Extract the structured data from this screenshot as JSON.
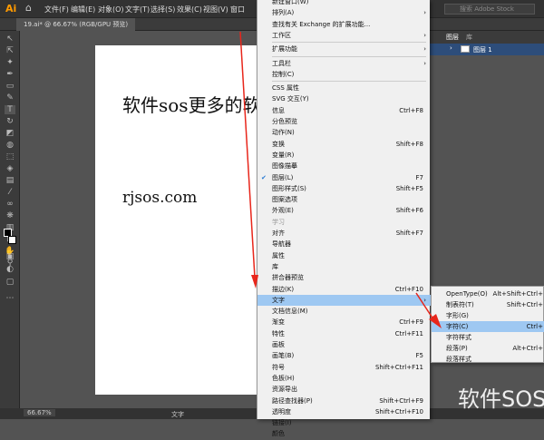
{
  "app": {
    "logo": "Ai",
    "window_title": "19.ai* @ 66.67% (RGB/GPU 预览)"
  },
  "menubar": [
    "文件(F)",
    "编辑(E)",
    "对象(O)",
    "文字(T)",
    "选择(S)",
    "效果(C)",
    "视图(V)",
    "窗口"
  ],
  "search": {
    "placeholder": "搜索 Adobe Stock"
  },
  "canvas": {
    "heading": "软件sos更多的软件",
    "url": "rjsos.com"
  },
  "status": {
    "zoom": "66.67%",
    "tool": "文字"
  },
  "layers": {
    "tabs": [
      "图层",
      "库"
    ],
    "layer_name": "图层 1"
  },
  "window_menu": [
    {
      "label": "新建窗口(W)",
      "shortcut": "",
      "arrow": false
    },
    {
      "label": "排列(A)",
      "shortcut": "",
      "arrow": true
    },
    {
      "label": "查找有关 Exchange 的扩展功能...",
      "shortcut": "",
      "arrow": false
    },
    {
      "label": "工作区",
      "shortcut": "",
      "arrow": true
    },
    {
      "label": "扩展功能",
      "shortcut": "",
      "arrow": true
    },
    {
      "label": "工具栏",
      "shortcut": "",
      "arrow": true
    },
    {
      "label": "控制(C)",
      "shortcut": "",
      "arrow": false
    },
    {
      "label": "CSS 属性",
      "shortcut": "",
      "arrow": false
    },
    {
      "label": "SVG 交互(Y)",
      "shortcut": "",
      "arrow": false
    },
    {
      "label": "信息",
      "shortcut": "Ctrl+F8",
      "arrow": false
    },
    {
      "label": "分色预览",
      "shortcut": "",
      "arrow": false
    },
    {
      "label": "动作(N)",
      "shortcut": "",
      "arrow": false
    },
    {
      "label": "变换",
      "shortcut": "Shift+F8",
      "arrow": false
    },
    {
      "label": "变量(R)",
      "shortcut": "",
      "arrow": false
    },
    {
      "label": "图像描摹",
      "shortcut": "",
      "arrow": false
    },
    {
      "label": "图层(L)",
      "shortcut": "F7",
      "arrow": false,
      "checked": true
    },
    {
      "label": "图形样式(S)",
      "shortcut": "Shift+F5",
      "arrow": false
    },
    {
      "label": "图案选项",
      "shortcut": "",
      "arrow": false
    },
    {
      "label": "外观(E)",
      "shortcut": "Shift+F6",
      "arrow": false
    },
    {
      "label": "学习",
      "shortcut": "",
      "arrow": false,
      "disabled": true
    },
    {
      "label": "对齐",
      "shortcut": "Shift+F7",
      "arrow": false
    },
    {
      "label": "导航器",
      "shortcut": "",
      "arrow": false
    },
    {
      "label": "属性",
      "shortcut": "",
      "arrow": false
    },
    {
      "label": "库",
      "shortcut": "",
      "arrow": false
    },
    {
      "label": "拼合器预览",
      "shortcut": "",
      "arrow": false
    },
    {
      "label": "描边(K)",
      "shortcut": "Ctrl+F10",
      "arrow": false
    },
    {
      "label": "文字",
      "shortcut": "",
      "arrow": true,
      "highlighted": true
    },
    {
      "label": "文档信息(M)",
      "shortcut": "",
      "arrow": false
    },
    {
      "label": "渐变",
      "shortcut": "Ctrl+F9",
      "arrow": false
    },
    {
      "label": "特性",
      "shortcut": "Ctrl+F11",
      "arrow": false
    },
    {
      "label": "画板",
      "shortcut": "",
      "arrow": false
    },
    {
      "label": "画笔(B)",
      "shortcut": "F5",
      "arrow": false
    },
    {
      "label": "符号",
      "shortcut": "Shift+Ctrl+F11",
      "arrow": false
    },
    {
      "label": "色板(H)",
      "shortcut": "",
      "arrow": false
    },
    {
      "label": "资源导出",
      "shortcut": "",
      "arrow": false
    },
    {
      "label": "路径查找器(P)",
      "shortcut": "Shift+Ctrl+F9",
      "arrow": false
    },
    {
      "label": "透明度",
      "shortcut": "Shift+Ctrl+F10",
      "arrow": false
    },
    {
      "label": "链接(I)",
      "shortcut": "",
      "arrow": false
    },
    {
      "label": "颜色",
      "shortcut": "",
      "arrow": false
    }
  ],
  "type_submenu": [
    {
      "label": "OpenType(O)",
      "shortcut": "Alt+Shift+Ctrl+"
    },
    {
      "label": "制表符(T)",
      "shortcut": "Shift+Ctrl+"
    },
    {
      "label": "字形(G)",
      "shortcut": ""
    },
    {
      "label": "字符(C)",
      "shortcut": "Ctrl+",
      "highlighted": true
    },
    {
      "label": "字符样式",
      "shortcut": ""
    },
    {
      "label": "段落(P)",
      "shortcut": "Alt+Ctrl+"
    },
    {
      "label": "段落样式",
      "shortcut": ""
    }
  ],
  "watermark": "软件SOS",
  "colors": {
    "highlight": "#9ec8f2",
    "arrow": "#e8261b",
    "ui_dark": "#323232",
    "accent": "#ff9a00"
  }
}
